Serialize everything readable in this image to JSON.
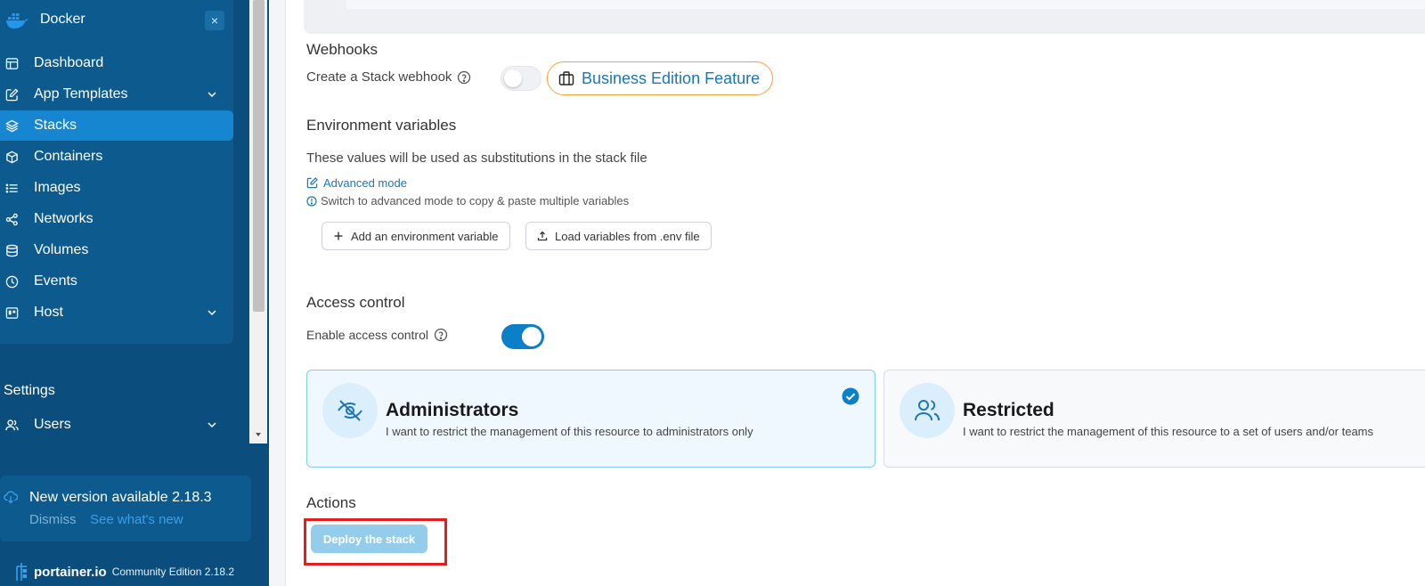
{
  "sidebar": {
    "environment_name": "Docker",
    "close_label": "×",
    "items": [
      {
        "label": "Dashboard",
        "icon": "dashboard-icon"
      },
      {
        "label": "App Templates",
        "icon": "edit-icon",
        "expandable": true
      },
      {
        "label": "Stacks",
        "icon": "layers-icon",
        "active": true
      },
      {
        "label": "Containers",
        "icon": "box-icon"
      },
      {
        "label": "Images",
        "icon": "list-icon"
      },
      {
        "label": "Networks",
        "icon": "share-icon"
      },
      {
        "label": "Volumes",
        "icon": "database-icon"
      },
      {
        "label": "Events",
        "icon": "clock-icon"
      },
      {
        "label": "Host",
        "icon": "host-icon",
        "expandable": true
      }
    ],
    "settings_title": "Settings",
    "settings_items": [
      {
        "label": "Users",
        "icon": "users-icon",
        "expandable": true
      }
    ],
    "update": {
      "text": "New version available 2.18.3",
      "dismiss": "Dismiss",
      "whats_new": "See what's new"
    },
    "footer": {
      "brand": "portainer.io",
      "edition": "Community Edition 2.18.2"
    }
  },
  "webhooks": {
    "title": "Webhooks",
    "label": "Create a Stack webhook",
    "badge": "Business Edition Feature"
  },
  "env_vars": {
    "title": "Environment variables",
    "description": "These values will be used as substitutions in the stack file",
    "advanced_link": "Advanced mode",
    "hint": "Switch to advanced mode to copy & paste multiple variables",
    "add_button": "Add an environment variable",
    "load_button": "Load variables from .env file"
  },
  "access_control": {
    "title": "Access control",
    "enable_label": "Enable access control",
    "cards": [
      {
        "title": "Administrators",
        "description": "I want to restrict the management of this resource to administrators only",
        "selected": true
      },
      {
        "title": "Restricted",
        "description": "I want to restrict the management of this resource to a set of users and/or teams",
        "selected": false
      }
    ]
  },
  "actions": {
    "title": "Actions",
    "deploy_button": "Deploy the stack"
  },
  "colors": {
    "sidebar_bg": "#0b4d7c",
    "active_item": "#1586cf",
    "accent": "#0b7fc7",
    "badge_border": "#f4a13a",
    "highlight": "#e41e1e"
  }
}
